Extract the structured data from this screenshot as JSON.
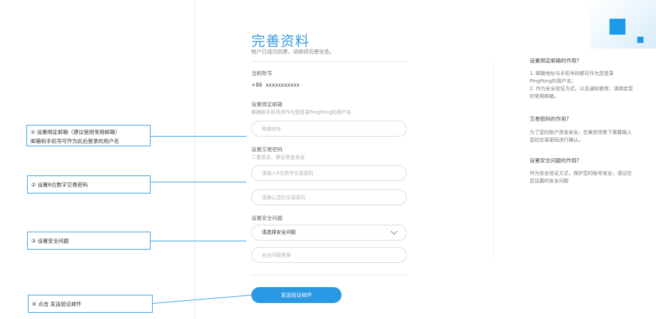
{
  "page": {
    "title": "完善资料",
    "subtitle": "帐户已成功创建，请继续完善信息。"
  },
  "account": {
    "label": "当前账号",
    "country_code": "+86",
    "masked_number": "xxxxxxxxxxx"
  },
  "email": {
    "label": "设置绑定邮箱",
    "hint": "邮箱和手机号将作为您登录PingPong的用户名",
    "placeholder": "邮箱地址"
  },
  "pin": {
    "label": "设置交易密码",
    "hint": "二重验证，保证资金安全",
    "placeholder": "请输入6位数字交易密码",
    "confirm_placeholder": "请确认您的交易密码"
  },
  "security": {
    "label": "设置安全问题",
    "question_selected": "请选择安全问题",
    "answer_placeholder": "安全问题答案"
  },
  "actions": {
    "send_label": "发送验证邮件"
  },
  "faq": [
    {
      "q": "设置绑定邮箱的作用?",
      "a": "1. 邮箱地址与手机号码都可作为您登录PingPong的用户名；\n2. 作为安全验证方式，以及通知使用；请绑定您的常用邮箱。"
    },
    {
      "q": "交易密码的作用?",
      "a": "为了您的账户资金安全，在某些场景下需要输入您的交易密码进行确认。"
    },
    {
      "q": "设置安全问题的作用?",
      "a": "作为安全验证方式，保护您的账号安全；请记住您设置的安全问题"
    }
  ],
  "callouts": [
    {
      "line1": "① 设置绑定邮箱（建议使用常用邮箱）",
      "line2": "邮箱和手机号可作为此后登录的用户名"
    },
    {
      "line1": "② 设置6位数字交易密码"
    },
    {
      "line1": "③ 设置安全问题"
    },
    {
      "line1": "④ 点击 发送验证邮件"
    }
  ],
  "colors": {
    "accent": "#2a98e2",
    "callout_border": "#39a3e3",
    "title": "#3a9be0"
  }
}
